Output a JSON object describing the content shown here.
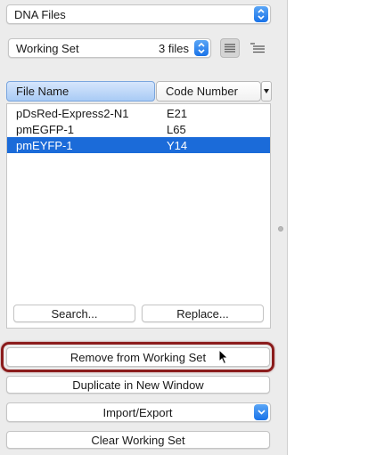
{
  "top_popup": {
    "label": "DNA Files"
  },
  "set_popup": {
    "label": "Working Set",
    "count": "3 files"
  },
  "view_buttons": [
    {
      "icon": "list-view-icon",
      "active": true
    },
    {
      "icon": "outline-view-icon",
      "active": false
    }
  ],
  "table": {
    "columns": [
      {
        "label": "File Name",
        "sorted": true
      },
      {
        "label": "Code Number",
        "sorted": false
      }
    ],
    "column_menu_icon": "chevron-down-icon",
    "rows": [
      {
        "name": "pDsRed-Express2-N1",
        "code": "E21",
        "selected": false
      },
      {
        "name": "pmEGFP-1",
        "code": "L65",
        "selected": false
      },
      {
        "name": "pmEYFP-1",
        "code": "Y14",
        "selected": true
      }
    ],
    "search_label": "Search...",
    "replace_label": "Replace..."
  },
  "actions": {
    "remove_label": "Remove from Working Set",
    "duplicate_label": "Duplicate in New Window",
    "import_export_label": "Import/Export",
    "clear_label": "Clear Working Set"
  },
  "colors": {
    "accent": "#1a73e8",
    "selection": "#1b6bd9",
    "highlight_ring": "#8b1c1c"
  }
}
